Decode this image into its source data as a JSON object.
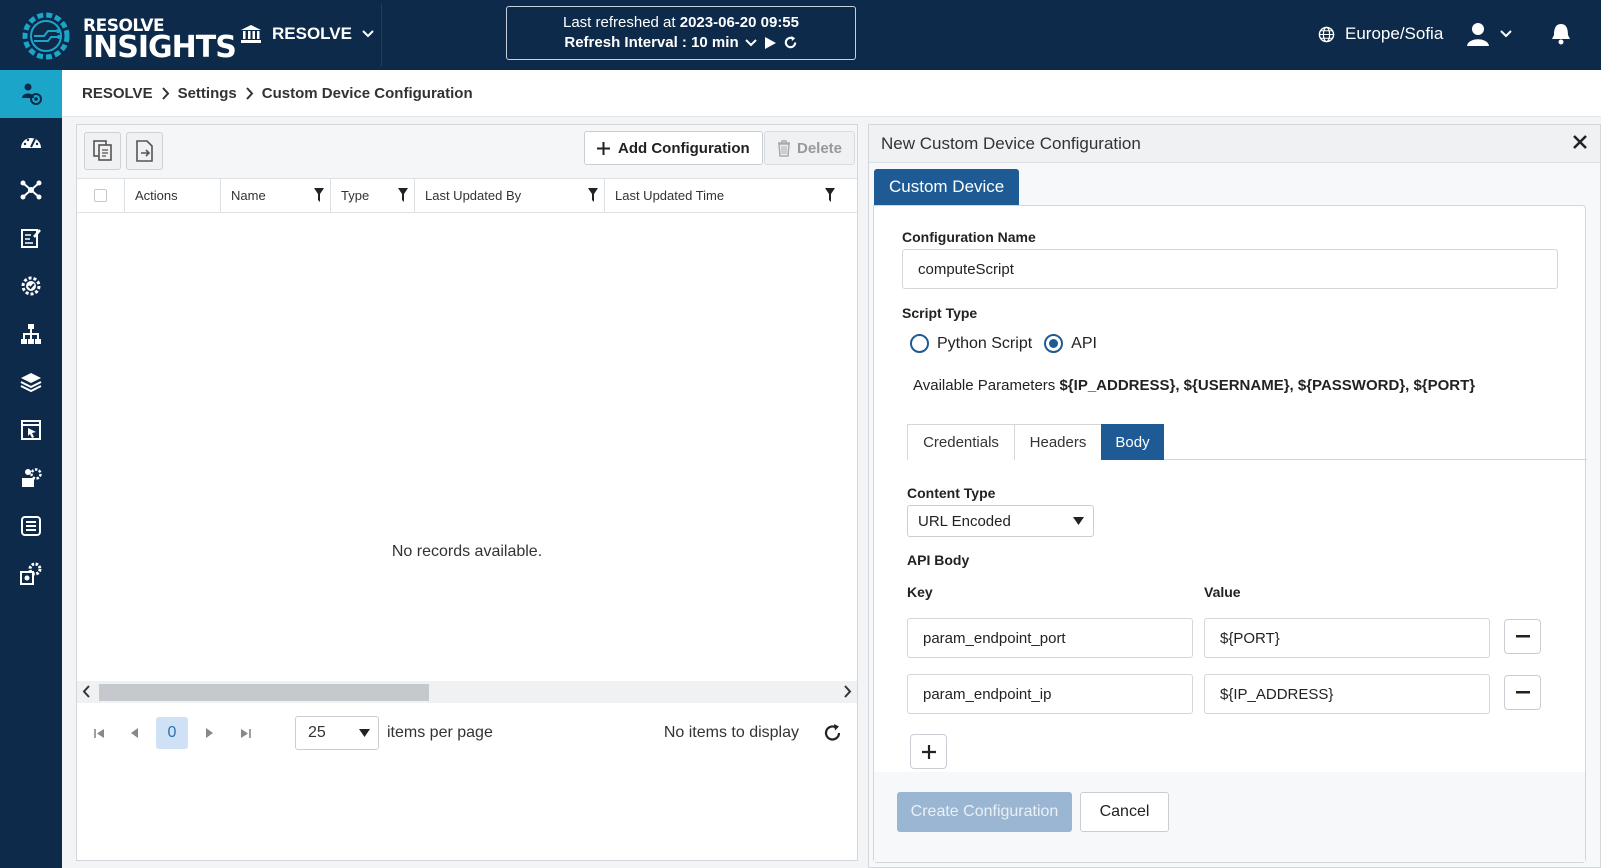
{
  "header": {
    "logo_top": "RESOLVE",
    "logo_bottom": "INSIGHTS",
    "org_name": "RESOLVE",
    "refresh_label": "Last refreshed at",
    "refresh_time": "2023-06-20 09:55",
    "refresh_interval": "Refresh Interval : 10 min",
    "timezone": "Europe/Sofia"
  },
  "sidebar": {
    "items": [
      {
        "icon": "user-network-icon",
        "active": true
      },
      {
        "icon": "dashboard-gauge-icon"
      },
      {
        "icon": "network-nodes-icon"
      },
      {
        "icon": "edit-document-icon"
      },
      {
        "icon": "settings-check-icon"
      },
      {
        "icon": "hierarchy-icon"
      },
      {
        "icon": "layers-icon"
      },
      {
        "icon": "cursor-window-icon"
      },
      {
        "icon": "automation-icon"
      },
      {
        "icon": "database-icon"
      },
      {
        "icon": "config-gears-icon"
      }
    ]
  },
  "breadcrumb": [
    "RESOLVE",
    "Settings",
    "Custom Device Configuration"
  ],
  "grid": {
    "add_label": "Add Configuration",
    "delete_label": "Delete",
    "columns": [
      "Actions",
      "Name",
      "Type",
      "Last Updated By",
      "Last Updated Time"
    ],
    "empty_text": "No records available.",
    "page": "0",
    "per_page": "25",
    "per_page_label": "items per page",
    "status": "No items to display"
  },
  "dialog": {
    "title": "New Custom Device Configuration",
    "main_tab": "Custom Device",
    "config_name_label": "Configuration Name",
    "config_name_value": "computeScript",
    "script_type_label": "Script Type",
    "script_options": [
      "Python Script",
      "API"
    ],
    "selected_script": "API",
    "params_label": "Available Parameters",
    "params_value": "${IP_ADDRESS}, ${USERNAME}, ${PASSWORD}, ${PORT}",
    "subtabs": [
      "Credentials",
      "Headers",
      "Body"
    ],
    "active_subtab": "Body",
    "content_type_label": "Content Type",
    "content_type_value": "URL Encoded",
    "api_body_label": "API Body",
    "key_label": "Key",
    "value_label": "Value",
    "rows": [
      {
        "key": "param_endpoint_port",
        "value": "${PORT}"
      },
      {
        "key": "param_endpoint_ip",
        "value": "${IP_ADDRESS}"
      }
    ],
    "create_label": "Create Configuration",
    "cancel_label": "Cancel"
  },
  "colors": {
    "nav_bg": "#0d2a4a",
    "accent": "#1ba6c9",
    "primary": "#1e5b94",
    "disabled_primary": "#9bb6d2"
  }
}
